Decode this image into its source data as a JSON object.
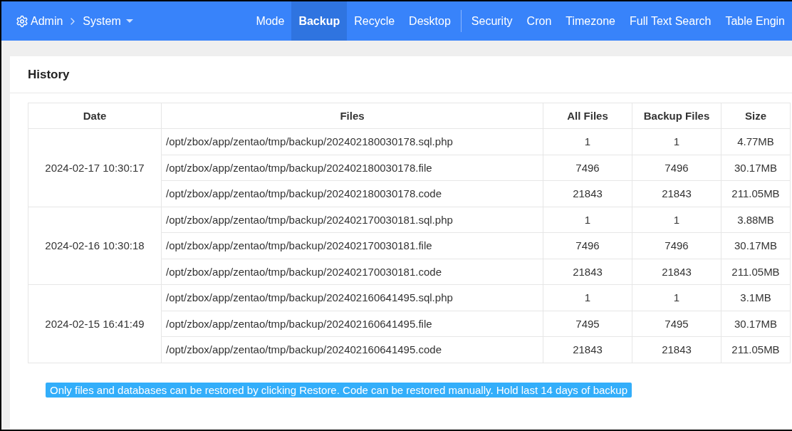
{
  "navbar": {
    "breadcrumb": [
      {
        "label": "Admin",
        "kind": "settings"
      },
      {
        "label": "System",
        "kind": "dropdown"
      }
    ],
    "nav_groups": [
      [
        {
          "label": "Mode",
          "selected": false
        },
        {
          "label": "Backup",
          "selected": true
        },
        {
          "label": "Recycle",
          "selected": false
        },
        {
          "label": "Desktop",
          "selected": false
        }
      ],
      [
        {
          "label": "Security",
          "selected": false
        },
        {
          "label": "Cron",
          "selected": false
        },
        {
          "label": "Timezone",
          "selected": false
        },
        {
          "label": "Full Text Search",
          "selected": false
        },
        {
          "label": "Table Engin",
          "selected": false
        }
      ]
    ]
  },
  "panel": {
    "title": "History",
    "table": {
      "columns": [
        "Date",
        "Files",
        "All Files",
        "Backup Files",
        "Size"
      ],
      "groups": [
        {
          "date": "2024-02-17 10:30:17",
          "files": [
            [
              "/opt/zbox/app/zentao/tmp/backup/202402180030178.sql.php",
              "1",
              "1",
              "4.77MB"
            ],
            [
              "/opt/zbox/app/zentao/tmp/backup/202402180030178.file",
              "7496",
              "7496",
              "30.17MB"
            ],
            [
              "/opt/zbox/app/zentao/tmp/backup/202402180030178.code",
              "21843",
              "21843",
              "211.05MB"
            ]
          ]
        },
        {
          "date": "2024-02-16 10:30:18",
          "files": [
            [
              "/opt/zbox/app/zentao/tmp/backup/202402170030181.sql.php",
              "1",
              "1",
              "3.88MB"
            ],
            [
              "/opt/zbox/app/zentao/tmp/backup/202402170030181.file",
              "7496",
              "7496",
              "30.17MB"
            ],
            [
              "/opt/zbox/app/zentao/tmp/backup/202402170030181.code",
              "21843",
              "21843",
              "211.05MB"
            ]
          ]
        },
        {
          "date": "2024-02-15 16:41:49",
          "files": [
            [
              "/opt/zbox/app/zentao/tmp/backup/202402160641495.sql.php",
              "1",
              "1",
              "3.1MB"
            ],
            [
              "/opt/zbox/app/zentao/tmp/backup/202402160641495.file",
              "7495",
              "7495",
              "30.17MB"
            ],
            [
              "/opt/zbox/app/zentao/tmp/backup/202402160641495.code",
              "21843",
              "21843",
              "211.05MB"
            ]
          ]
        }
      ]
    },
    "notice": "Only files and databases can be restored by clicking Restore. Code can be restored manually. Hold last 14 days of backup"
  }
}
